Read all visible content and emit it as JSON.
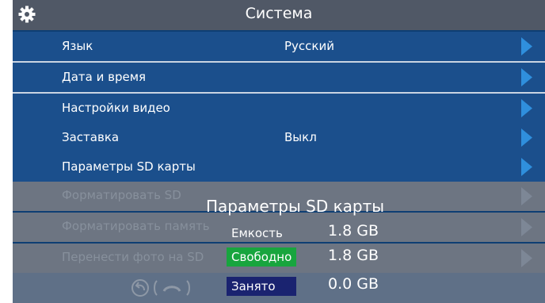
{
  "header": {
    "title": "Система",
    "icon": "gear-icon"
  },
  "menu": [
    {
      "label": "Язык",
      "value": "Русский"
    },
    {
      "label": "Дата и время",
      "value": ""
    },
    {
      "label": "Настройки видео",
      "value": ""
    },
    {
      "label": "Заставка",
      "value": "Выкл"
    },
    {
      "label": "Параметры SD карты",
      "value": ""
    }
  ],
  "disabled_menu": [
    {
      "label": "Форматировать SD"
    },
    {
      "label": "Форматировать память"
    },
    {
      "label": "Перенести фото на SD"
    }
  ],
  "sd_popup": {
    "title": "Параметры SD карты",
    "capacity_label": "Емкость",
    "capacity_value": "1.8 GB",
    "free_label": "Свободно",
    "free_value": "1.8 GB",
    "used_label": "Занято",
    "used_value": "0.0 GB"
  },
  "colors": {
    "row": "#1b4f8c",
    "arrow": "#2f8fdd",
    "free_badge": "#18a53e",
    "used_badge": "#1a2370"
  },
  "footer_icons": [
    "back-icon",
    "hangup-icon"
  ]
}
